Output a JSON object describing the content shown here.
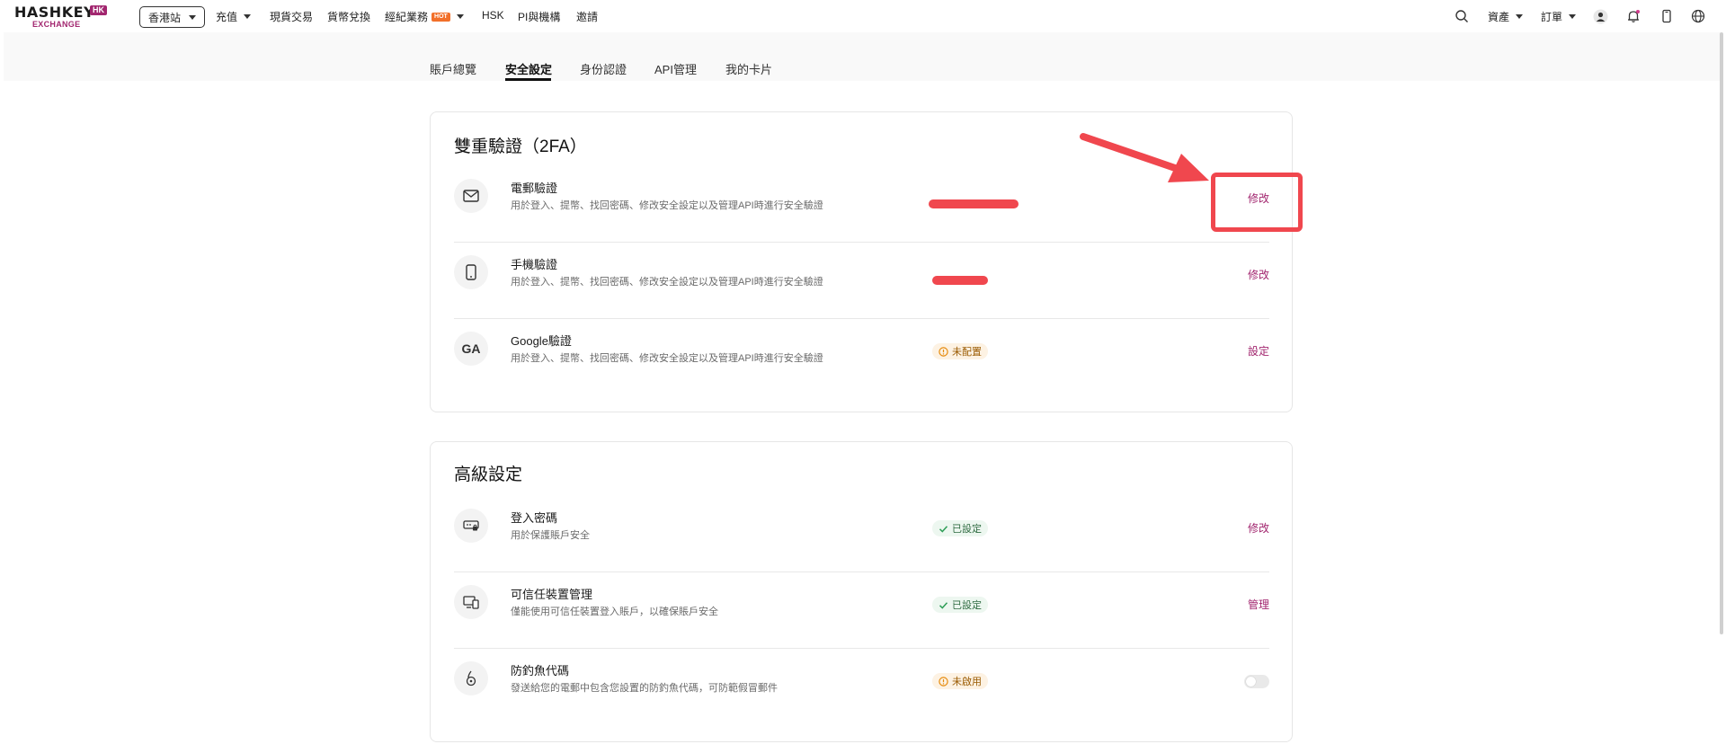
{
  "nav": {
    "logo_text": "HASHKEY",
    "logo_badge": "HK",
    "logo_sub": "EXCHANGE",
    "site_selector": "香港站",
    "items": [
      {
        "label": "充值",
        "has_caret": true
      },
      {
        "label": "現貨交易"
      },
      {
        "label": "貨幣兌換"
      },
      {
        "label": "經紀業務",
        "badge": "HOT",
        "has_caret": true
      },
      {
        "label": "HSK"
      },
      {
        "label": "PI與機構"
      },
      {
        "label": "邀請"
      }
    ],
    "right": {
      "assets": "資產",
      "orders": "訂單"
    },
    "icons": [
      "search-icon",
      "user-avatar-icon",
      "bell-icon",
      "phone-icon",
      "globe-icon"
    ]
  },
  "tabs": [
    {
      "label": "賬戶總覽",
      "active": false
    },
    {
      "label": "安全設定",
      "active": true
    },
    {
      "label": "身份認證",
      "active": false
    },
    {
      "label": "API管理",
      "active": false
    },
    {
      "label": "我的卡片",
      "active": false
    }
  ],
  "twofa": {
    "title": "雙重驗證（2FA）",
    "rows": [
      {
        "icon": "envelope-icon",
        "title": "電郵驗證",
        "desc": "用於登入、提幣、找回密碼、修改安全設定以及管理API時進行安全驗證",
        "action": "修改",
        "status": "redacted"
      },
      {
        "icon": "mobile-phone-icon",
        "title": "手機驗證",
        "desc": "用於登入、提幣、找回密碼、修改安全設定以及管理API時進行安全驗證",
        "action": "修改",
        "status": "redacted"
      },
      {
        "icon": "google-authenticator-icon",
        "icon_text": "GA",
        "title": "Google驗證",
        "desc": "用於登入、提幣、找回密碼、修改安全設定以及管理API時進行安全驗證",
        "status": "未配置",
        "action": "設定"
      }
    ]
  },
  "advanced": {
    "title": "高級設定",
    "rows": [
      {
        "icon": "password-icon",
        "title": "登入密碼",
        "desc": "用於保護賬戶安全",
        "status": "已設定",
        "action": "修改"
      },
      {
        "icon": "trusted-device-icon",
        "title": "可信任裝置管理",
        "desc": "僅能使用可信任裝置登入賬戶，以確保賬戶安全",
        "status": "已設定",
        "action": "管理"
      },
      {
        "icon": "anti-phishing-icon",
        "title": "防釣魚代碼",
        "desc": "發送給您的電郵中包含您設置的防釣魚代碼，可防範假冒郵件",
        "status": "未啟用",
        "toggle_on": false
      }
    ]
  },
  "colors": {
    "accent": "#a2266f",
    "annotation": "#f0474e",
    "warn": "#e5890a",
    "ok": "#2e9e57"
  }
}
